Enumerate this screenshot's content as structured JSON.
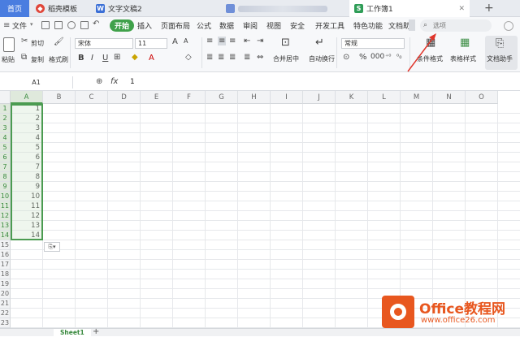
{
  "tabs": [
    {
      "label": "首页",
      "icon": "home-tab",
      "color": "#4a7de0"
    },
    {
      "label": "稻壳模板",
      "icon": "docer-icon",
      "color": "#e0463a"
    },
    {
      "label": "文字文稿2",
      "icon": "word-doc-icon",
      "color": "#3b6fd6"
    },
    {
      "label": "",
      "icon": "blurred-doc-icon",
      "color": "#6f8fd8"
    },
    {
      "label": "工作簿1",
      "icon": "spreadsheet-icon",
      "color": "#2f9d57"
    }
  ],
  "menubar": {
    "file": "文件",
    "items": [
      "开始",
      "插入",
      "页面布局",
      "公式",
      "数据",
      "审阅",
      "视图",
      "安全",
      "开发工具",
      "特色功能",
      "文档助"
    ],
    "search_placeholder": "选项",
    "accent": "#3fa14a"
  },
  "ribbon": {
    "paste": "粘贴",
    "cut": "剪切",
    "copy": "复制",
    "format_painter": "格式刷",
    "font_name": "宋体",
    "font_size": "11",
    "merge_center": "合并居中",
    "wrap_text": "自动换行",
    "number_format": "常规",
    "conditional_format": "条件格式",
    "table_style": "表格样式",
    "doc_helper": "文档助手"
  },
  "formula_bar": {
    "cell_ref": "A1",
    "fx": "fx",
    "value": "1"
  },
  "sheet": {
    "columns": [
      "A",
      "B",
      "C",
      "D",
      "E",
      "F",
      "G",
      "H",
      "I",
      "J",
      "K",
      "L",
      "M",
      "N",
      "O"
    ],
    "rows": [
      "1",
      "2",
      "3",
      "4",
      "5",
      "6",
      "7",
      "8",
      "9",
      "10",
      "11",
      "12",
      "13",
      "14",
      "15",
      "16",
      "17",
      "18",
      "19",
      "20",
      "21",
      "22",
      "23"
    ],
    "column_a_values": [
      "1",
      "2",
      "3",
      "4",
      "5",
      "6",
      "7",
      "8",
      "9",
      "10",
      "11",
      "12",
      "13",
      "14"
    ],
    "selection": "A1:A14",
    "selection_color": "#4b9b51"
  },
  "sheet_tabs": {
    "active": "Sheet1",
    "add": "+"
  },
  "watermark": {
    "title": "Office教程网",
    "url": "www.office26.com",
    "color": "#e8571f"
  }
}
